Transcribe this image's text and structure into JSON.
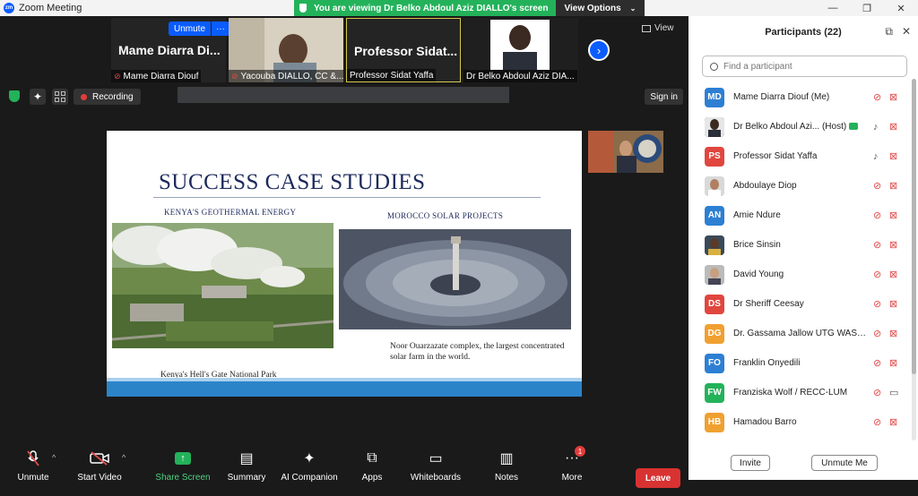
{
  "window": {
    "title": "Zoom Meeting",
    "minimize": "—",
    "maximize": "❐",
    "close": "✕"
  },
  "banner": {
    "text": "You are viewing Dr Belko Abdoul Aziz DIALLO's screen",
    "options_label": "View Options"
  },
  "gallery": {
    "thumbs": [
      {
        "big_name": "Mame Diarra Di...",
        "label": "Mame Diarra Diouf"
      },
      {
        "big_name": "",
        "label": "Yacouba DIALLO, CC &..."
      },
      {
        "big_name": "Professor Sidat...",
        "label": "Professor Sidat Yaffa"
      },
      {
        "big_name": "",
        "label": "Dr Belko Abdoul Aziz DIA..."
      }
    ],
    "unmute_label": "Unmute",
    "more_label": "···",
    "view_label": "View"
  },
  "top_tools": {
    "recording_label": "Recording",
    "sign_in_label": "Sign in"
  },
  "slide": {
    "title": "SUCCESS CASE STUDIES",
    "left_caption": "KENYA'S GEOTHERMAL ENERGY",
    "right_caption": "MOROCCO SOLAR PROJECTS",
    "left_footer": "Kenya's Hell's Gate National Park",
    "right_footer": "Noor Ouarzazate complex, the largest concentrated solar farm in the world."
  },
  "toolbar": {
    "items": [
      {
        "label": "Unmute",
        "icon": "mic-off-icon"
      },
      {
        "label": "Start Video",
        "icon": "video-off-icon"
      },
      {
        "label": "Share Screen",
        "icon": "share-screen-icon"
      },
      {
        "label": "Summary",
        "icon": "summary-icon"
      },
      {
        "label": "AI Companion",
        "icon": "ai-sparkle-icon"
      },
      {
        "label": "Apps",
        "icon": "apps-icon"
      },
      {
        "label": "Whiteboards",
        "icon": "whiteboard-icon"
      },
      {
        "label": "Notes",
        "icon": "notes-icon"
      },
      {
        "label": "More",
        "icon": "more-icon"
      }
    ],
    "more_badge": "1",
    "leave_label": "Leave"
  },
  "participants": {
    "title": "Participants (22)",
    "search_placeholder": "Find a participant",
    "list": [
      {
        "initials": "MD",
        "name": "Mame Diarra Diouf (Me)",
        "color": "#2d7fd3",
        "mic": "muted",
        "cam": "off"
      },
      {
        "initials": "",
        "name": "Dr Belko Abdoul Azi...",
        "tag": "(Host)",
        "color": "#3a3a3a",
        "mic": "on",
        "cam": "off",
        "sharing": true
      },
      {
        "initials": "PS",
        "name": "Professor Sidat Yaffa",
        "color": "#e0463e",
        "mic": "on",
        "cam": "off"
      },
      {
        "initials": "",
        "name": "Abdoulaye Diop",
        "color": "#cfcfcf",
        "mic": "muted",
        "cam": "off"
      },
      {
        "initials": "AN",
        "name": "Amie Ndure",
        "color": "#2d7fd3",
        "mic": "muted",
        "cam": "off"
      },
      {
        "initials": "",
        "name": "Brice Sinsin",
        "color": "#445",
        "mic": "muted",
        "cam": "off"
      },
      {
        "initials": "",
        "name": "David Young",
        "color": "#888",
        "mic": "muted",
        "cam": "off"
      },
      {
        "initials": "DS",
        "name": "Dr Sheriff Ceesay",
        "color": "#e0463e",
        "mic": "muted",
        "cam": "off"
      },
      {
        "initials": "DG",
        "name": "Dr. Gassama Jallow UTG WASC...",
        "color": "#f0a030",
        "mic": "muted",
        "cam": "off"
      },
      {
        "initials": "FO",
        "name": "Franklin Onyedili",
        "color": "#2d7fd3",
        "mic": "muted",
        "cam": "off"
      },
      {
        "initials": "FW",
        "name": "Franziska Wolf / RECC-LUM",
        "color": "#23b25a",
        "mic": "muted",
        "cam": "on"
      },
      {
        "initials": "HB",
        "name": "Hamadou Barro",
        "color": "#f0a030",
        "mic": "muted",
        "cam": "off"
      }
    ],
    "invite_label": "Invite",
    "unmute_me_label": "Unmute Me"
  }
}
